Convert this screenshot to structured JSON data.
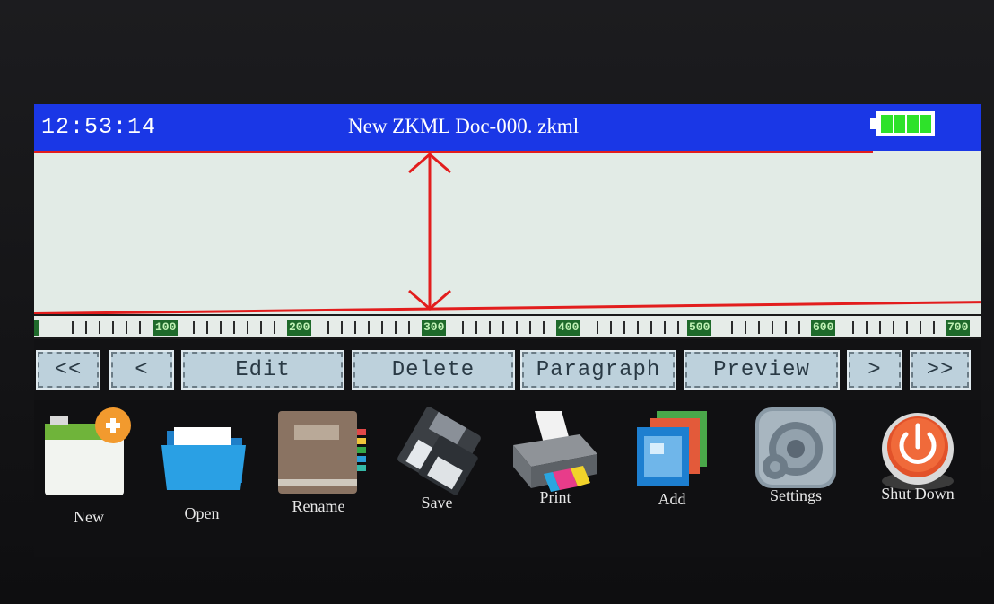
{
  "status_bar": {
    "time": "12:53:14",
    "document_title": "New ZKML Doc-000. zkml",
    "battery_icon": "battery-full-icon",
    "battery_color": "#2ee22a",
    "bar_color": "#1a37e6"
  },
  "ruler": {
    "labels": [
      "100",
      "200",
      "300",
      "400",
      "500",
      "600",
      "700"
    ]
  },
  "toolbar": {
    "first_label": "<<",
    "prev_label": "<",
    "edit_label": "Edit",
    "delete_label": "Delete",
    "paragraph_label": "Paragraph",
    "preview_label": "Preview",
    "next_label": ">",
    "last_label": ">>"
  },
  "dock": {
    "items": [
      {
        "label": "New",
        "icon": "new-document-icon"
      },
      {
        "label": "Open",
        "icon": "folder-icon"
      },
      {
        "label": "Rename",
        "icon": "notebook-icon"
      },
      {
        "label": "Save",
        "icon": "floppy-disk-icon"
      },
      {
        "label": "Print",
        "icon": "printer-icon"
      },
      {
        "label": "Add",
        "icon": "add-pages-icon"
      },
      {
        "label": "Settings",
        "icon": "gear-icon"
      },
      {
        "label": "Shut Down",
        "icon": "power-icon"
      }
    ]
  }
}
